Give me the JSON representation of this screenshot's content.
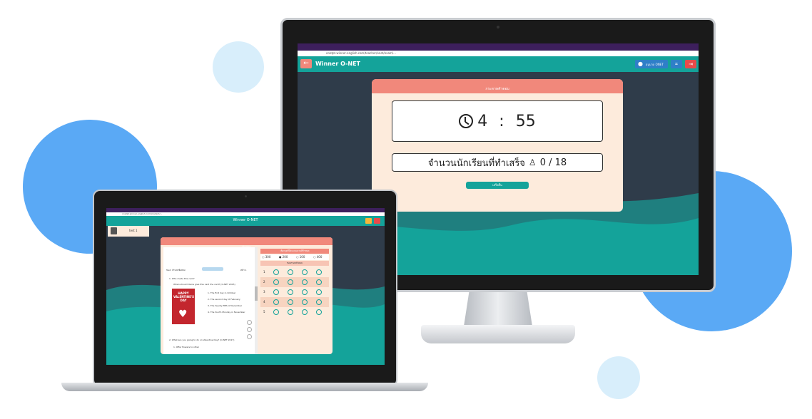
{
  "monitor": {
    "url": "onetpt.winner-english.com/teacher/onet/exam/...",
    "app_title": "Winner O-NET",
    "back_icon": "arrow-left-icon",
    "user_label": "อนุบาล ONET",
    "card_title": "กระดาษคำตอบ",
    "timer": {
      "minutes": "4",
      "seconds": "55",
      "separator": ":"
    },
    "students_label": "จำนวนนักเรียนที่ทำเสร็จ",
    "students_done": "0 / 18",
    "button_label": "เสร็จสิ้น"
  },
  "laptop": {
    "url": "onetpt.winner-english.com/student/...",
    "app_title": "Winner O-NET",
    "sidebar_item": "test 1",
    "card_title": "ข้อสอบ",
    "answer_panel_title": "เลือกจุดที่มีคะแนนตามที่กำหนด",
    "score_options": [
      "300",
      "200",
      "100",
      "400"
    ],
    "answer_section_title": "ช่องกรอกคำตอบ",
    "question_numbers": [
      "1",
      "2",
      "3",
      "4",
      "5"
    ],
    "doc_header_left": "Test: จำนวนข้อสอบ",
    "doc_header_right": "หน้า 1",
    "poster_text": "HAPPY VALENTINE'S DAY",
    "doc_lines": [
      "1. Who made this card?",
      "When should Claire give this card the card? (O-NET 2015)",
      "1. The first day in October",
      "2. The second day of February",
      "3. The twenty-fifth of December",
      "4. The fourth Monday in November",
      "2. What are you going to do on Valentine Day? (O-NET 2017)",
      "1. Offer flowers to other"
    ]
  },
  "colors": {
    "teal": "#14a39a",
    "salmon": "#f1887b",
    "peach": "#fdebdc",
    "dark": "#2f3c4a",
    "browser_purple": "#3d1f5c",
    "blue_blob": "#5aa9f5",
    "light_blob": "#d8eefb"
  }
}
